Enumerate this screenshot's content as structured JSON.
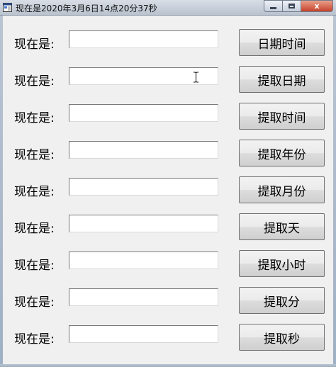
{
  "window": {
    "title": "现在是2020年3月6日14点20分37秒",
    "controls": {
      "minimize_icon": "minimize-icon",
      "maximize_icon": "maximize-icon",
      "close_icon": "close-icon",
      "close_glyph": "x"
    }
  },
  "rows": [
    {
      "label": "现在是:",
      "value": "",
      "button": "日期时间"
    },
    {
      "label": "现在是:",
      "value": "",
      "button": "提取日期"
    },
    {
      "label": "现在是:",
      "value": "",
      "button": "提取时间"
    },
    {
      "label": "现在是:",
      "value": "",
      "button": "提取年份"
    },
    {
      "label": "现在是:",
      "value": "",
      "button": "提取月份"
    },
    {
      "label": "现在是:",
      "value": "",
      "button": "提取天"
    },
    {
      "label": "现在是:",
      "value": "",
      "button": "提取小时"
    },
    {
      "label": "现在是:",
      "value": "",
      "button": "提取分"
    },
    {
      "label": "现在是:",
      "value": "",
      "button": "提取秒"
    }
  ],
  "colors": {
    "face": "#f0f0f0",
    "close": "#c7412a"
  }
}
